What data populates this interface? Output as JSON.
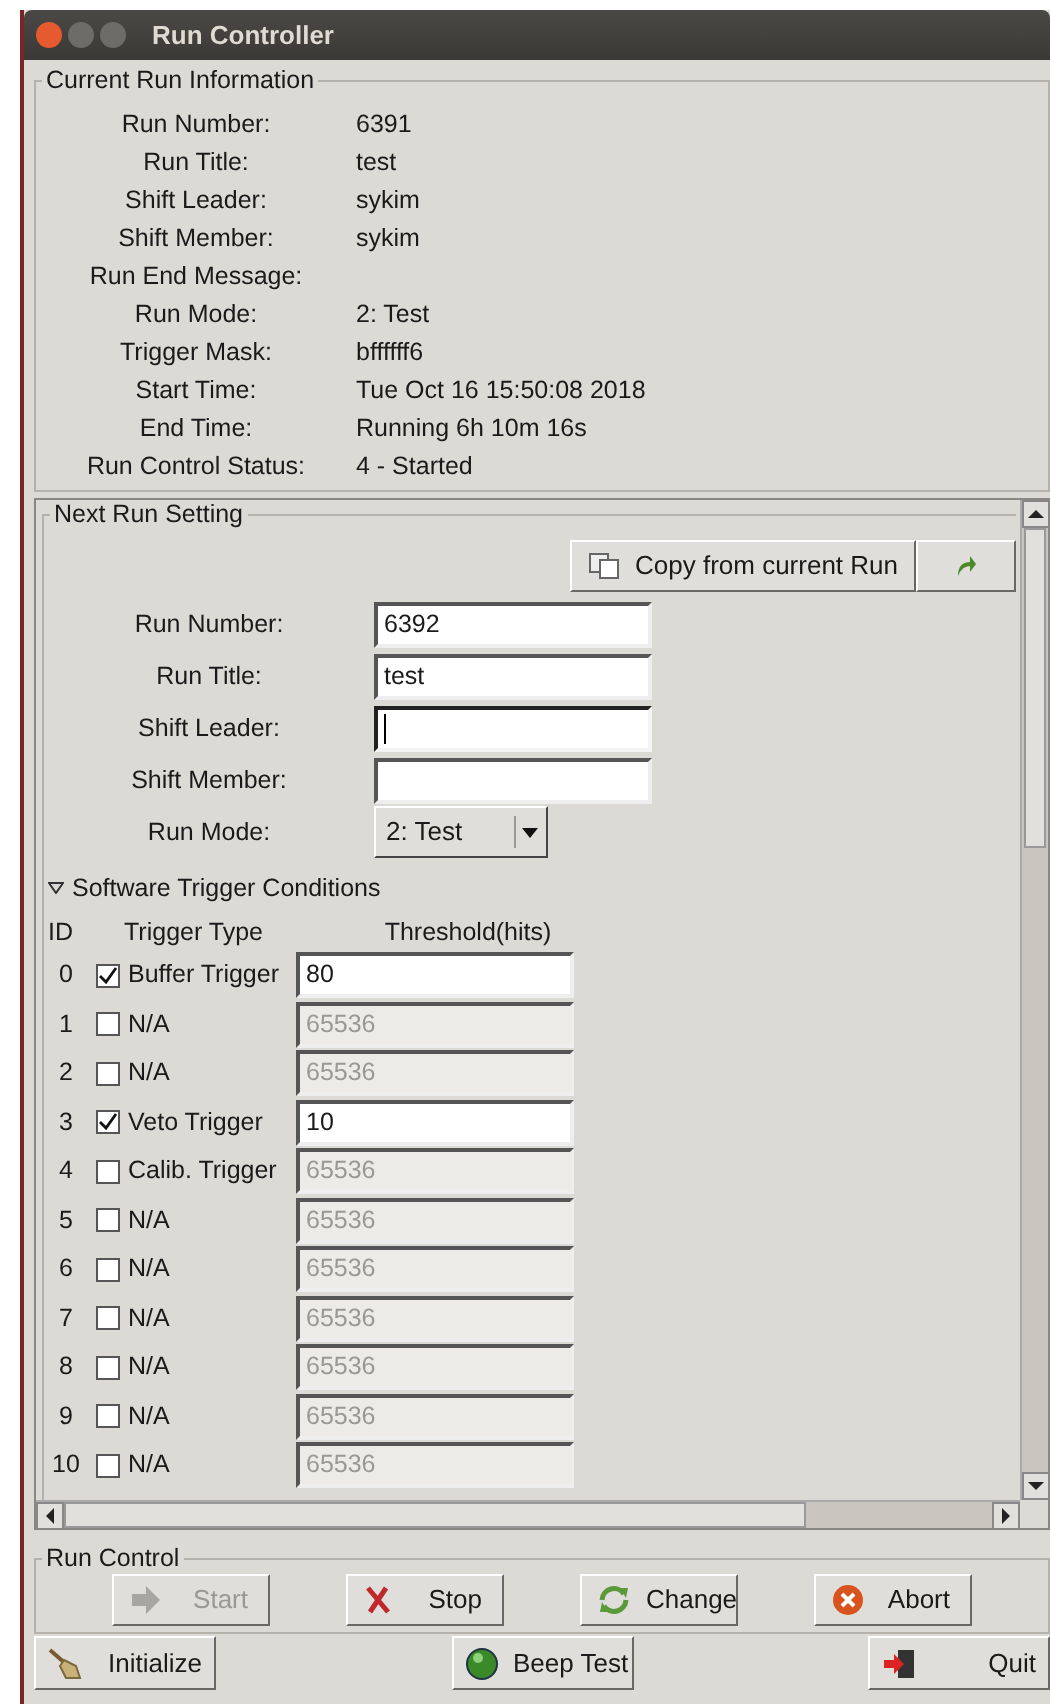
{
  "window": {
    "title": "Run Controller"
  },
  "current_run": {
    "title": "Current Run Information",
    "fields": [
      {
        "label": "Run Number:",
        "value": "6391"
      },
      {
        "label": "Run Title:",
        "value": "test"
      },
      {
        "label": "Shift Leader:",
        "value": "sykim"
      },
      {
        "label": "Shift Member:",
        "value": "sykim"
      },
      {
        "label": "Run End Message:"
      },
      {
        "label": "Run Mode:",
        "value": "2: Test"
      },
      {
        "label": "Trigger Mask:",
        "value": "bffffff6"
      },
      {
        "label": "Start Time:",
        "value": "Tue Oct 16 15:50:08 2018"
      },
      {
        "label": "End Time:",
        "value": "Running 6h 10m 16s"
      },
      {
        "label": "Run Control Status:",
        "value": "4 - Started"
      }
    ]
  },
  "next_run": {
    "title": "Next Run Setting",
    "copy_button": "Copy from current Run",
    "fields": [
      {
        "label": "Run Number:",
        "kind": "text",
        "value": "6392",
        "focused": false
      },
      {
        "label": "Run Title:",
        "kind": "text",
        "value": "test",
        "focused": false
      },
      {
        "label": "Shift Leader:",
        "kind": "text",
        "focused": true
      },
      {
        "label": "Shift Member:",
        "kind": "text",
        "focused": false
      },
      {
        "label": "Run Mode:",
        "kind": "select",
        "value": "2: Test",
        "focused": false
      }
    ],
    "triggers": {
      "title": "Software Trigger Conditions",
      "expanded": true,
      "columns": [
        "ID",
        "Trigger Type",
        "Threshold(hits)"
      ],
      "rows": [
        {
          "id": "0",
          "checked": true,
          "type": "Buffer Trigger",
          "threshold": "80"
        },
        {
          "id": "1",
          "checked": false,
          "type": "N/A",
          "threshold": "65536"
        },
        {
          "id": "2",
          "checked": false,
          "type": "N/A",
          "threshold": "65536"
        },
        {
          "id": "3",
          "checked": true,
          "type": "Veto Trigger",
          "threshold": "10"
        },
        {
          "id": "4",
          "checked": false,
          "type": "Calib. Trigger",
          "threshold": "65536"
        },
        {
          "id": "5",
          "checked": false,
          "type": "N/A",
          "threshold": "65536"
        },
        {
          "id": "6",
          "checked": false,
          "type": "N/A",
          "threshold": "65536"
        },
        {
          "id": "7",
          "checked": false,
          "type": "N/A",
          "threshold": "65536"
        },
        {
          "id": "8",
          "checked": false,
          "type": "N/A",
          "threshold": "65536"
        },
        {
          "id": "9",
          "checked": false,
          "type": "N/A",
          "threshold": "65536"
        },
        {
          "id": "10",
          "checked": false,
          "type": "N/A",
          "threshold": "65536"
        }
      ]
    }
  },
  "run_control": {
    "title": "Run Control",
    "buttons": [
      {
        "label": "Start",
        "kind": "arrow",
        "disabled": true
      },
      {
        "label": "Stop",
        "kind": "cross",
        "disabled": false
      },
      {
        "label": "Change",
        "kind": "cycle",
        "disabled": false
      },
      {
        "label": "Abort",
        "kind": "abort",
        "disabled": false
      }
    ]
  },
  "bottom_buttons": [
    {
      "label": "Initialize",
      "kind": "brush"
    },
    {
      "label": "Beep Test",
      "kind": "led"
    },
    {
      "label": "Quit",
      "kind": "exit"
    }
  ]
}
